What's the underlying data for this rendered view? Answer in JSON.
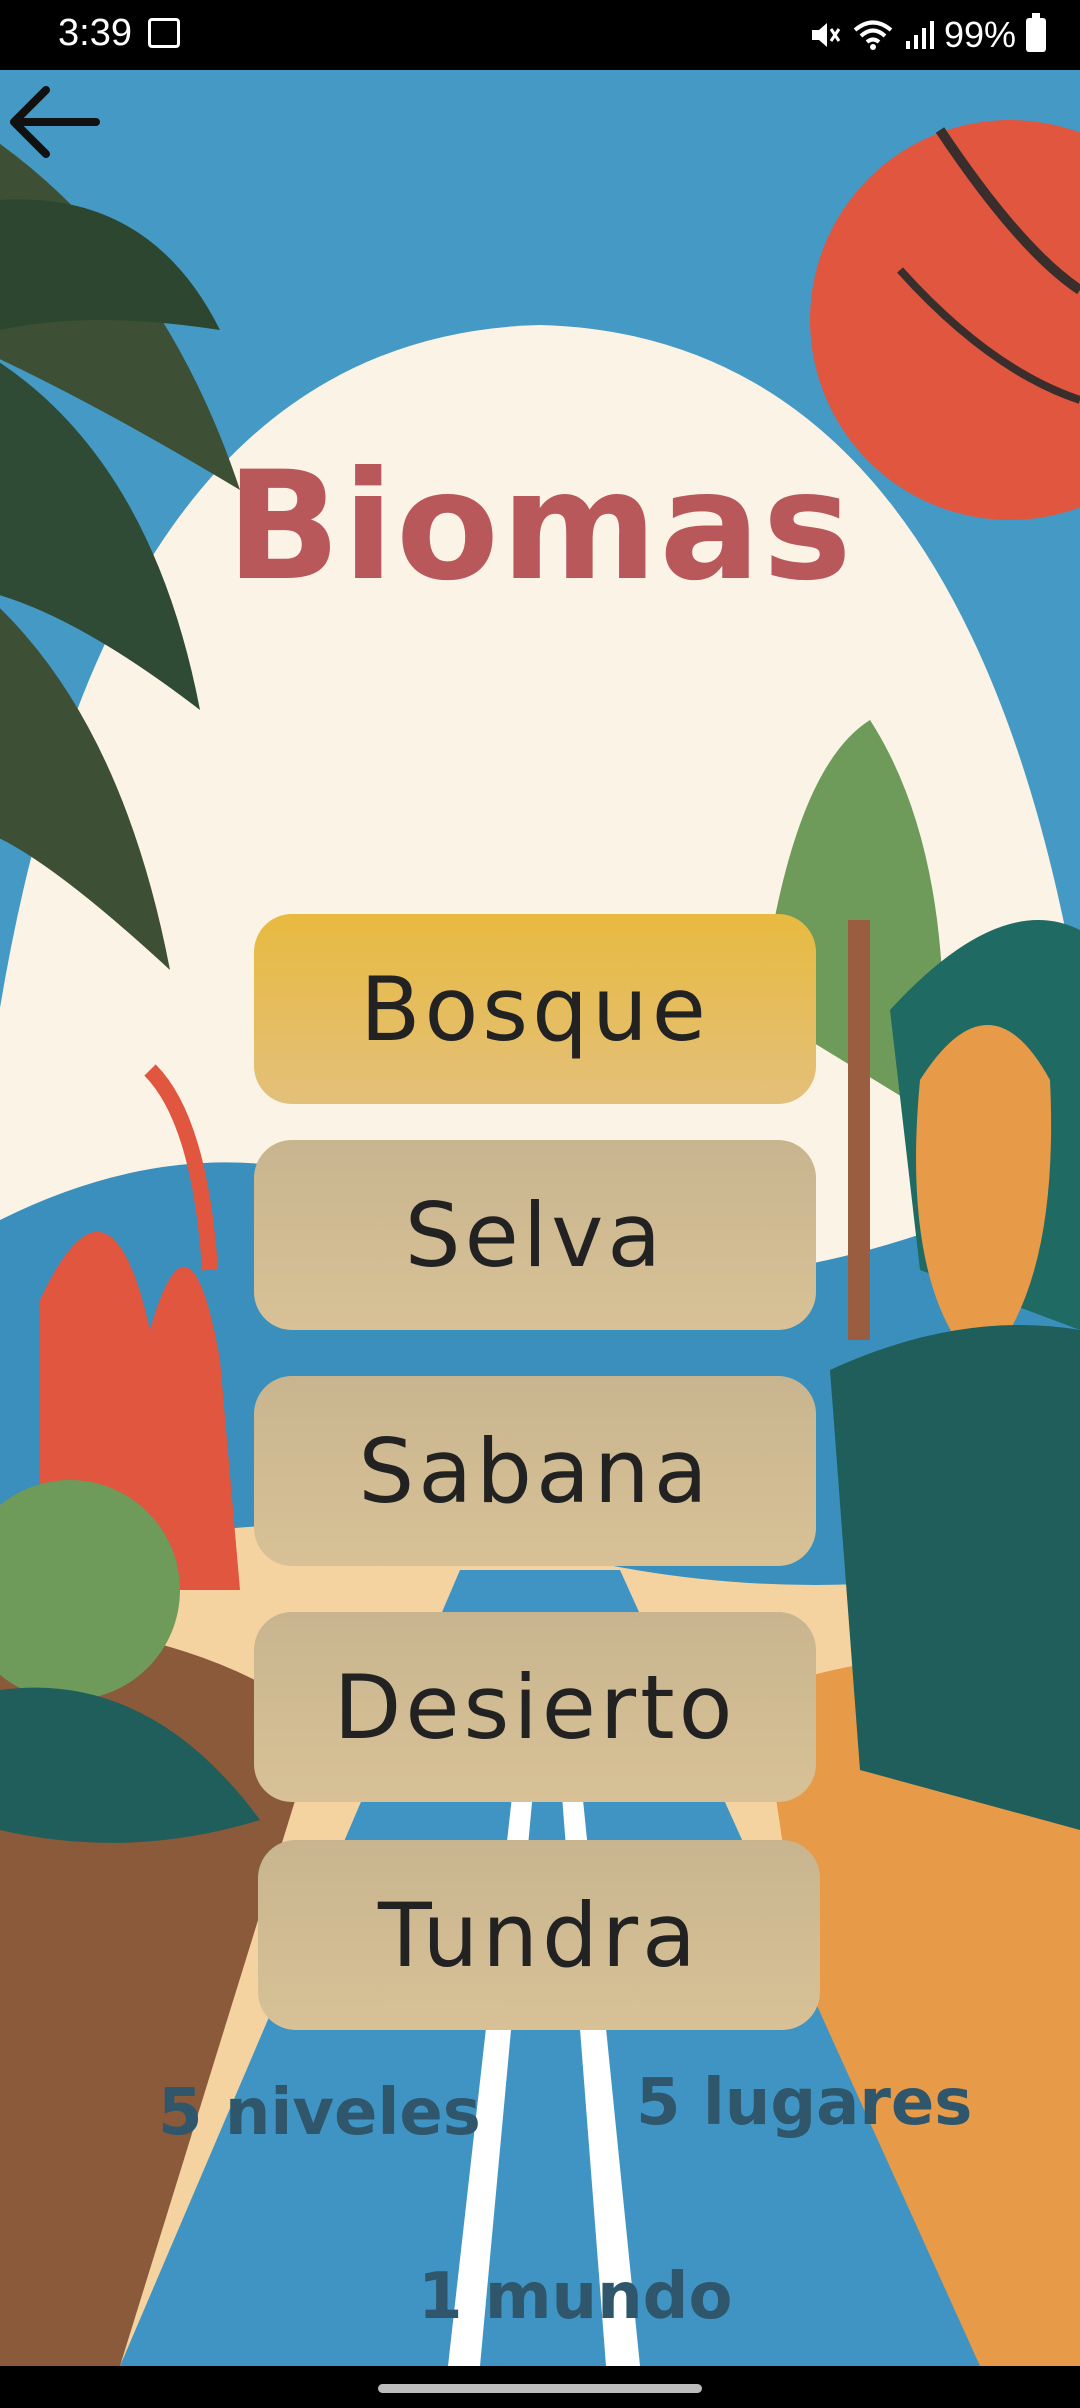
{
  "status_bar": {
    "time": "3:39",
    "battery": "99%",
    "icons": [
      "gallery-icon",
      "mute-icon",
      "wifi-icon",
      "signal-icon",
      "battery-icon"
    ]
  },
  "header": {
    "back_icon": "arrow-left-icon",
    "title": "Biomas"
  },
  "menu": {
    "items": [
      {
        "label": "Bosque",
        "selected": true
      },
      {
        "label": "Selva",
        "selected": false
      },
      {
        "label": "Sabana",
        "selected": false
      },
      {
        "label": "Desierto",
        "selected": false
      },
      {
        "label": "Tundra",
        "selected": false
      }
    ]
  },
  "stats": {
    "levels": "5 niveles",
    "places": "5 lugares",
    "worlds": "1 mundo"
  },
  "colors": {
    "title": "#b8585a",
    "selected_button": "#e8ba40",
    "button": "#d0bb93",
    "stats_text": "#2f566a",
    "sky": "#449ac4"
  }
}
